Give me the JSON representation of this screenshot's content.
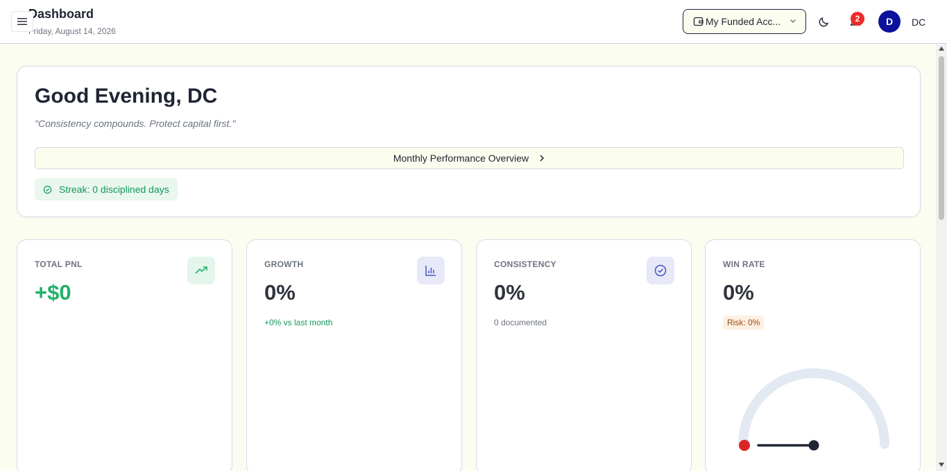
{
  "header": {
    "title": "Dashboard",
    "date": "Friday, August 14, 2026",
    "account_label": "My Funded Acc...",
    "notification_count": "2",
    "avatar_letter": "D",
    "user_initials": "DC"
  },
  "welcome": {
    "greeting": "Good Evening, DC",
    "quote": "\"Consistency compounds. Protect capital first.\"",
    "overview_button": "Monthly Performance Overview",
    "streak": "Streak: 0 disciplined days"
  },
  "stats": {
    "total_pnl": {
      "label": "TOTAL PNL",
      "value": "+$0",
      "icon": "trending-up-icon"
    },
    "growth": {
      "label": "GROWTH",
      "value": "0%",
      "sub": "+0% vs last month",
      "icon": "bar-chart-icon"
    },
    "consistency": {
      "label": "CONSISTENCY",
      "value": "0%",
      "sub": "0 documented",
      "icon": "check-circle-icon"
    },
    "win_rate": {
      "label": "WIN RATE",
      "value": "0%",
      "risk": "Risk: 0%",
      "gauge_fraction": 0
    }
  },
  "colors": {
    "accent_green": "#21b06b",
    "accent_blue": "#4752c4",
    "notification_red": "#ef2b2b",
    "avatar_navy": "#0c129c",
    "page_bg": "#fafdf0"
  }
}
